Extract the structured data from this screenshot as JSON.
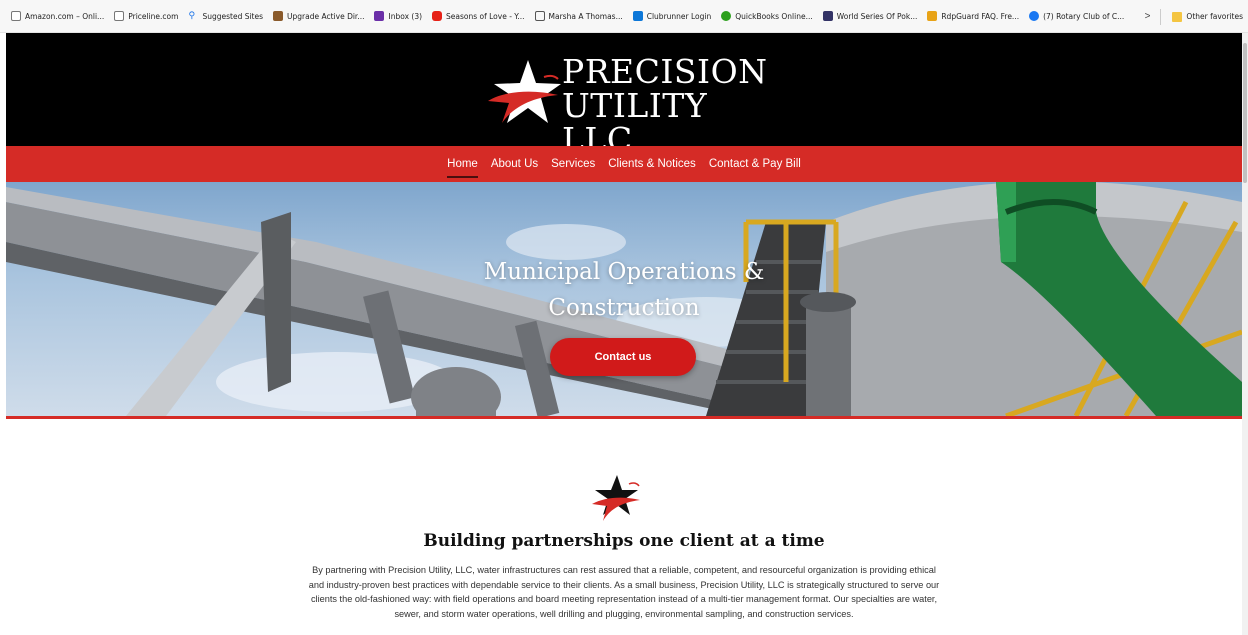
{
  "bookmarks": [
    {
      "label": "Amazon.com – Onli...",
      "icon": "page-icon",
      "color": "#666666"
    },
    {
      "label": "Priceline.com",
      "icon": "page-icon",
      "color": "#666666"
    },
    {
      "label": "Suggested Sites",
      "icon": "search-icon",
      "color": "#1a73e8"
    },
    {
      "label": "Upgrade Active Dir...",
      "icon": "square-icon",
      "color": "#8a5a2b"
    },
    {
      "label": "Inbox (3)",
      "icon": "mail-icon",
      "color": "#6b2fa8"
    },
    {
      "label": "Seasons of Love - Y...",
      "icon": "youtube-icon",
      "color": "#e62117"
    },
    {
      "label": "Marsha A Thomas...",
      "icon": "app-icon",
      "color": "#555555"
    },
    {
      "label": "Clubrunner Login",
      "icon": "app-icon",
      "color": "#0c77d8"
    },
    {
      "label": "QuickBooks Online...",
      "icon": "quickbooks-icon",
      "color": "#2ca01c"
    },
    {
      "label": "World Series Of Pok...",
      "icon": "app-icon",
      "color": "#333366"
    },
    {
      "label": "RdpGuard FAQ. Fre...",
      "icon": "shield-icon",
      "color": "#e8a317"
    },
    {
      "label": "(7) Rotary Club of C...",
      "icon": "facebook-icon",
      "color": "#1877f2"
    }
  ],
  "bookmarks_more": ">",
  "other_favorites": "Other favorites",
  "logo": {
    "line1": "PRECISION",
    "line2": "UTILITY LLC"
  },
  "nav": [
    {
      "label": "Home",
      "active": true
    },
    {
      "label": "About Us",
      "active": false
    },
    {
      "label": "Services",
      "active": false
    },
    {
      "label": "Clients & Notices",
      "active": false
    },
    {
      "label": "Contact & Pay Bill",
      "active": false
    }
  ],
  "hero": {
    "title": "Municipal Operations & Construction",
    "button": "Contact us"
  },
  "section": {
    "title": "Building partnerships one client at a time",
    "body": "By partnering with Precision Utility, LLC, water infrastructures can rest assured that a reliable, competent, and resourceful organization is providing ethical and industry-proven best practices with dependable service to their clients. As a small business, Precision Utility, LLC is strategically structured to serve our clients the old-fashioned way: with field operations and board meeting representation instead of a multi-tier management format. Our specialties are water, sewer, and storm water operations, well drilling and plugging, environmental sampling, and construction services."
  },
  "colors": {
    "brand_red": "#d52b26",
    "header_black": "#000000",
    "button_red": "#d11a1a"
  }
}
